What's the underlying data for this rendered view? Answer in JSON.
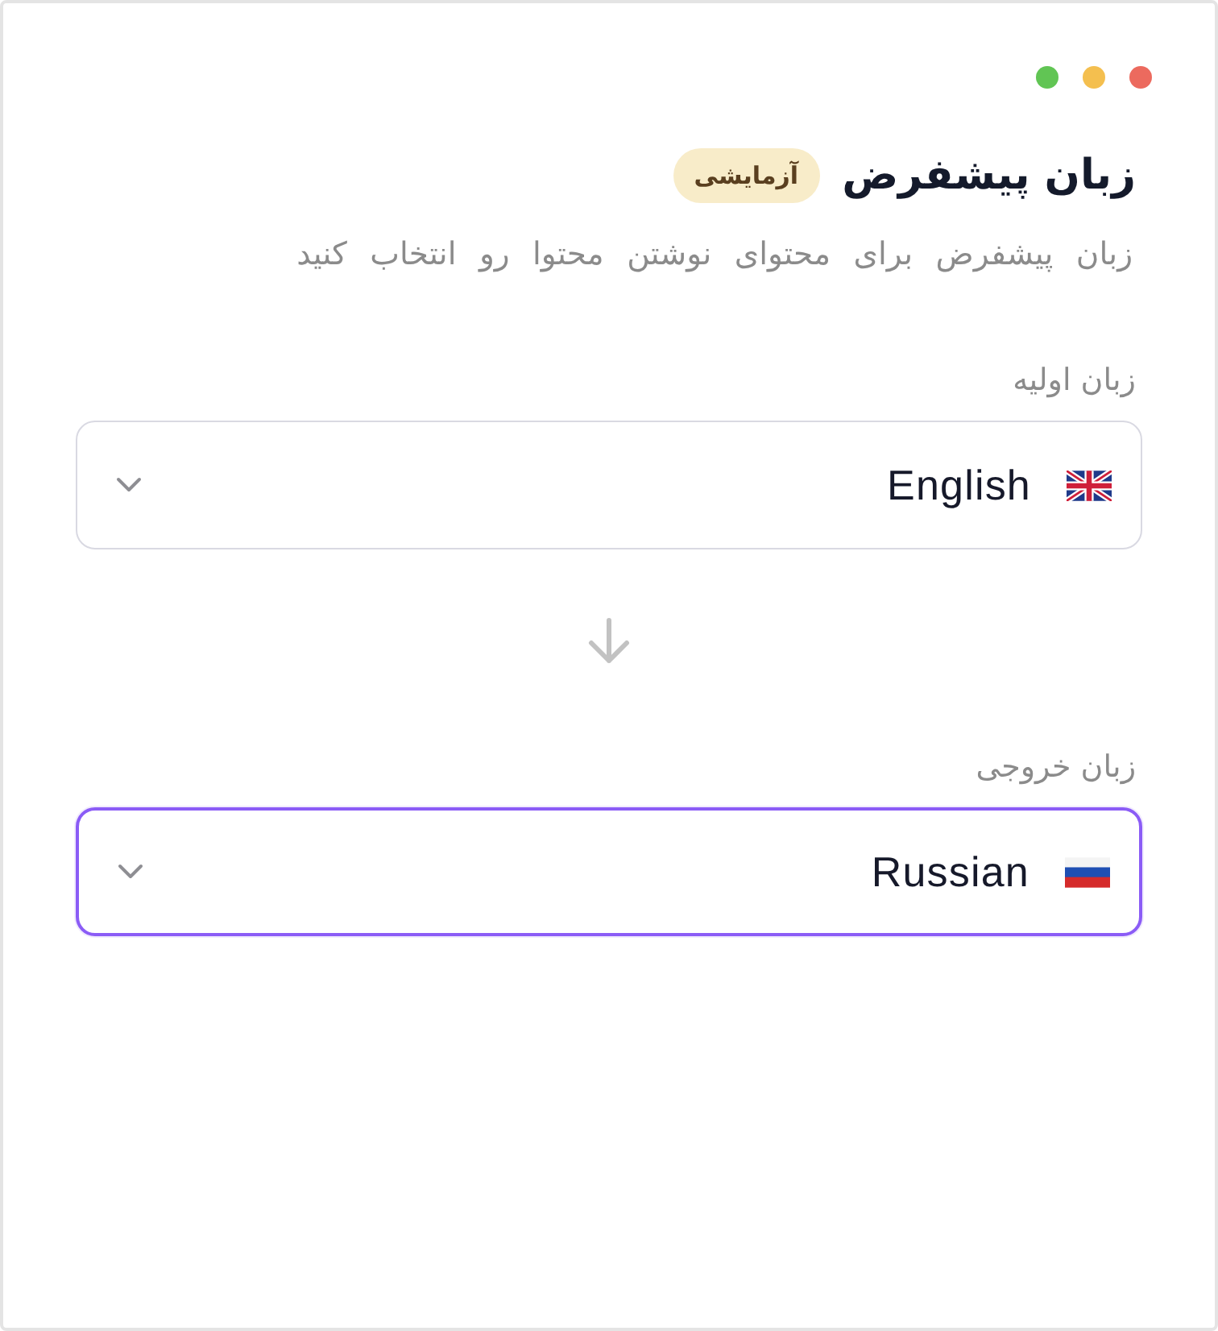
{
  "header": {
    "title": "زبان پیشفرض",
    "badge": "آزمایشی",
    "subtitle": "زبان پیشفرض برای محتوای نوشتن محتوا رو انتخاب کنید"
  },
  "fields": [
    {
      "label": "زبان اولیه",
      "value": "English",
      "kind": "uk",
      "focused": false
    },
    {
      "label": "زبان خروجی",
      "value": "Russian",
      "kind": "russia",
      "focused": true
    }
  ]
}
